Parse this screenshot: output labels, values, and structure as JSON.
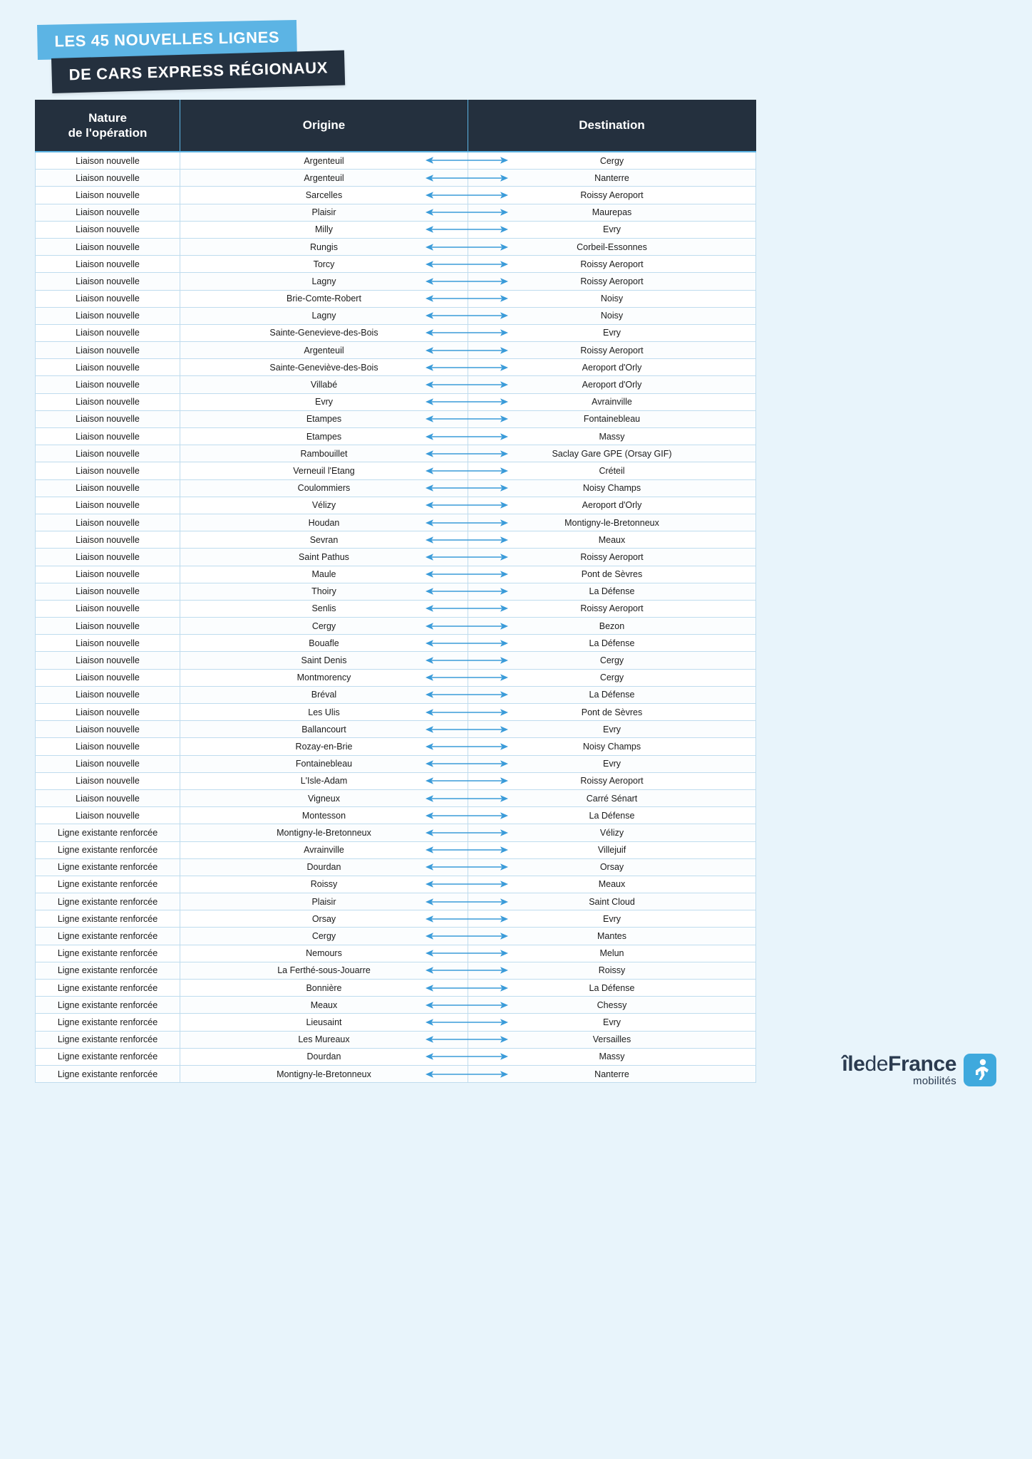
{
  "title": {
    "line1": "LES 45 NOUVELLES LIGNES",
    "line2": "DE CARS EXPRESS RÉGIONAUX"
  },
  "colors": {
    "page_background": "#e8f4fb",
    "header_dark": "#24303e",
    "accent_blue": "#5cb4e4",
    "arrow_blue": "#3a9bd9",
    "row_border": "#bfdcee"
  },
  "table": {
    "columns": [
      {
        "key": "nature",
        "label": "Nature\nde l'opération"
      },
      {
        "key": "origin",
        "label": "Origine"
      },
      {
        "key": "destination",
        "label": "Destination"
      }
    ],
    "header": {
      "nature_line1": "Nature",
      "nature_line2": "de l'opération",
      "origin": "Origine",
      "destination": "Destination"
    },
    "connector_icon": "double-headed-arrow",
    "rows": [
      {
        "nature": "Liaison nouvelle",
        "origin": "Argenteuil",
        "destination": "Cergy"
      },
      {
        "nature": "Liaison nouvelle",
        "origin": "Argenteuil",
        "destination": "Nanterre"
      },
      {
        "nature": "Liaison nouvelle",
        "origin": "Sarcelles",
        "destination": "Roissy Aeroport"
      },
      {
        "nature": "Liaison nouvelle",
        "origin": "Plaisir",
        "destination": "Maurepas"
      },
      {
        "nature": "Liaison nouvelle",
        "origin": "Milly",
        "destination": "Evry"
      },
      {
        "nature": "Liaison nouvelle",
        "origin": "Rungis",
        "destination": "Corbeil-Essonnes"
      },
      {
        "nature": "Liaison nouvelle",
        "origin": "Torcy",
        "destination": "Roissy Aeroport"
      },
      {
        "nature": "Liaison nouvelle",
        "origin": "Lagny",
        "destination": "Roissy Aeroport"
      },
      {
        "nature": "Liaison nouvelle",
        "origin": "Brie-Comte-Robert",
        "destination": "Noisy"
      },
      {
        "nature": "Liaison nouvelle",
        "origin": "Lagny",
        "destination": "Noisy"
      },
      {
        "nature": "Liaison nouvelle",
        "origin": "Sainte-Genevieve-des-Bois",
        "destination": "Evry"
      },
      {
        "nature": "Liaison nouvelle",
        "origin": "Argenteuil",
        "destination": "Roissy Aeroport"
      },
      {
        "nature": "Liaison nouvelle",
        "origin": "Sainte-Geneviève-des-Bois",
        "destination": "Aeroport d'Orly"
      },
      {
        "nature": "Liaison nouvelle",
        "origin": "Villabé",
        "destination": "Aeroport d'Orly"
      },
      {
        "nature": "Liaison nouvelle",
        "origin": "Evry",
        "destination": "Avrainville"
      },
      {
        "nature": "Liaison nouvelle",
        "origin": "Etampes",
        "destination": "Fontainebleau"
      },
      {
        "nature": "Liaison nouvelle",
        "origin": "Etampes",
        "destination": "Massy"
      },
      {
        "nature": "Liaison nouvelle",
        "origin": "Rambouillet",
        "destination": "Saclay Gare GPE (Orsay GIF)"
      },
      {
        "nature": "Liaison nouvelle",
        "origin": "Verneuil l'Etang",
        "destination": "Créteil"
      },
      {
        "nature": "Liaison nouvelle",
        "origin": "Coulommiers",
        "destination": "Noisy Champs"
      },
      {
        "nature": "Liaison nouvelle",
        "origin": "Vélizy",
        "destination": "Aeroport d'Orly"
      },
      {
        "nature": "Liaison nouvelle",
        "origin": "Houdan",
        "destination": "Montigny-le-Bretonneux"
      },
      {
        "nature": "Liaison nouvelle",
        "origin": "Sevran",
        "destination": "Meaux"
      },
      {
        "nature": "Liaison nouvelle",
        "origin": "Saint Pathus",
        "destination": "Roissy Aeroport"
      },
      {
        "nature": "Liaison nouvelle",
        "origin": "Maule",
        "destination": "Pont de Sèvres"
      },
      {
        "nature": "Liaison nouvelle",
        "origin": "Thoiry",
        "destination": "La Défense"
      },
      {
        "nature": "Liaison nouvelle",
        "origin": "Senlis",
        "destination": "Roissy Aeroport"
      },
      {
        "nature": "Liaison nouvelle",
        "origin": "Cergy",
        "destination": "Bezon"
      },
      {
        "nature": "Liaison nouvelle",
        "origin": "Bouafle",
        "destination": "La Défense"
      },
      {
        "nature": "Liaison nouvelle",
        "origin": "Saint Denis",
        "destination": "Cergy"
      },
      {
        "nature": "Liaison nouvelle",
        "origin": "Montmorency",
        "destination": "Cergy"
      },
      {
        "nature": "Liaison nouvelle",
        "origin": "Bréval",
        "destination": "La Défense"
      },
      {
        "nature": "Liaison nouvelle",
        "origin": "Les Ulis",
        "destination": "Pont de Sèvres"
      },
      {
        "nature": "Liaison nouvelle",
        "origin": "Ballancourt",
        "destination": "Evry"
      },
      {
        "nature": "Liaison nouvelle",
        "origin": "Rozay-en-Brie",
        "destination": "Noisy Champs"
      },
      {
        "nature": "Liaison nouvelle",
        "origin": "Fontainebleau",
        "destination": "Evry"
      },
      {
        "nature": "Liaison nouvelle",
        "origin": "L'Isle-Adam",
        "destination": "Roissy Aeroport"
      },
      {
        "nature": "Liaison nouvelle",
        "origin": "Vigneux",
        "destination": "Carré Sénart"
      },
      {
        "nature": "Liaison nouvelle",
        "origin": "Montesson",
        "destination": "La Défense"
      },
      {
        "nature": "Ligne existante renforcée",
        "origin": "Montigny-le-Bretonneux",
        "destination": "Vélizy"
      },
      {
        "nature": "Ligne existante renforcée",
        "origin": "Avrainville",
        "destination": "Villejuif"
      },
      {
        "nature": "Ligne existante renforcée",
        "origin": "Dourdan",
        "destination": "Orsay"
      },
      {
        "nature": "Ligne existante renforcée",
        "origin": "Roissy",
        "destination": "Meaux"
      },
      {
        "nature": "Ligne existante renforcée",
        "origin": "Plaisir",
        "destination": "Saint Cloud"
      },
      {
        "nature": "Ligne existante renforcée",
        "origin": "Orsay",
        "destination": "Evry"
      },
      {
        "nature": "Ligne existante renforcée",
        "origin": "Cergy",
        "destination": "Mantes"
      },
      {
        "nature": "Ligne existante renforcée",
        "origin": "Nemours",
        "destination": "Melun"
      },
      {
        "nature": "Ligne existante renforcée",
        "origin": "La  Ferthé-sous-Jouarre",
        "destination": "Roissy"
      },
      {
        "nature": "Ligne existante renforcée",
        "origin": "Bonnière",
        "destination": "La Défense"
      },
      {
        "nature": "Ligne existante renforcée",
        "origin": "Meaux",
        "destination": "Chessy"
      },
      {
        "nature": "Ligne existante renforcée",
        "origin": "Lieusaint",
        "destination": "Evry"
      },
      {
        "nature": "Ligne existante renforcée",
        "origin": "Les Mureaux",
        "destination": "Versailles"
      },
      {
        "nature": "Ligne existante renforcée",
        "origin": "Dourdan",
        "destination": "Massy"
      },
      {
        "nature": "Ligne existante renforcée",
        "origin": "Montigny-le-Bretonneux",
        "destination": "Nanterre"
      }
    ]
  },
  "logo": {
    "name_part1": "île",
    "name_part2": "de",
    "name_part3": "France",
    "subtitle": "mobilités",
    "mark": "running-person-icon"
  }
}
